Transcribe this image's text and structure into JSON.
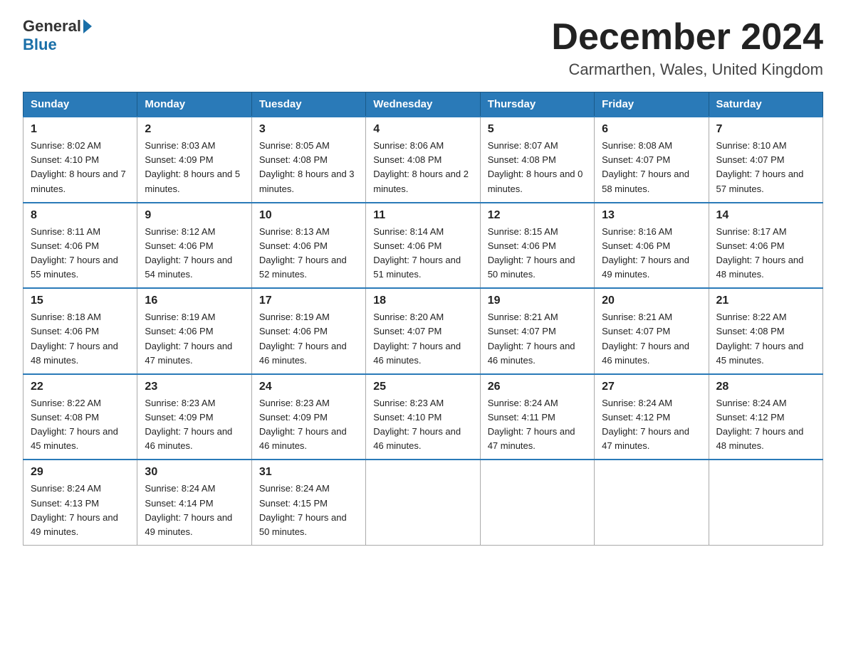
{
  "logo": {
    "general": "General",
    "blue": "Blue"
  },
  "title": "December 2024",
  "location": "Carmarthen, Wales, United Kingdom",
  "weekdays": [
    "Sunday",
    "Monday",
    "Tuesday",
    "Wednesday",
    "Thursday",
    "Friday",
    "Saturday"
  ],
  "weeks": [
    [
      {
        "day": "1",
        "sunrise": "8:02 AM",
        "sunset": "4:10 PM",
        "daylight": "8 hours and 7 minutes."
      },
      {
        "day": "2",
        "sunrise": "8:03 AM",
        "sunset": "4:09 PM",
        "daylight": "8 hours and 5 minutes."
      },
      {
        "day": "3",
        "sunrise": "8:05 AM",
        "sunset": "4:08 PM",
        "daylight": "8 hours and 3 minutes."
      },
      {
        "day": "4",
        "sunrise": "8:06 AM",
        "sunset": "4:08 PM",
        "daylight": "8 hours and 2 minutes."
      },
      {
        "day": "5",
        "sunrise": "8:07 AM",
        "sunset": "4:08 PM",
        "daylight": "8 hours and 0 minutes."
      },
      {
        "day": "6",
        "sunrise": "8:08 AM",
        "sunset": "4:07 PM",
        "daylight": "7 hours and 58 minutes."
      },
      {
        "day": "7",
        "sunrise": "8:10 AM",
        "sunset": "4:07 PM",
        "daylight": "7 hours and 57 minutes."
      }
    ],
    [
      {
        "day": "8",
        "sunrise": "8:11 AM",
        "sunset": "4:06 PM",
        "daylight": "7 hours and 55 minutes."
      },
      {
        "day": "9",
        "sunrise": "8:12 AM",
        "sunset": "4:06 PM",
        "daylight": "7 hours and 54 minutes."
      },
      {
        "day": "10",
        "sunrise": "8:13 AM",
        "sunset": "4:06 PM",
        "daylight": "7 hours and 52 minutes."
      },
      {
        "day": "11",
        "sunrise": "8:14 AM",
        "sunset": "4:06 PM",
        "daylight": "7 hours and 51 minutes."
      },
      {
        "day": "12",
        "sunrise": "8:15 AM",
        "sunset": "4:06 PM",
        "daylight": "7 hours and 50 minutes."
      },
      {
        "day": "13",
        "sunrise": "8:16 AM",
        "sunset": "4:06 PM",
        "daylight": "7 hours and 49 minutes."
      },
      {
        "day": "14",
        "sunrise": "8:17 AM",
        "sunset": "4:06 PM",
        "daylight": "7 hours and 48 minutes."
      }
    ],
    [
      {
        "day": "15",
        "sunrise": "8:18 AM",
        "sunset": "4:06 PM",
        "daylight": "7 hours and 48 minutes."
      },
      {
        "day": "16",
        "sunrise": "8:19 AM",
        "sunset": "4:06 PM",
        "daylight": "7 hours and 47 minutes."
      },
      {
        "day": "17",
        "sunrise": "8:19 AM",
        "sunset": "4:06 PM",
        "daylight": "7 hours and 46 minutes."
      },
      {
        "day": "18",
        "sunrise": "8:20 AM",
        "sunset": "4:07 PM",
        "daylight": "7 hours and 46 minutes."
      },
      {
        "day": "19",
        "sunrise": "8:21 AM",
        "sunset": "4:07 PM",
        "daylight": "7 hours and 46 minutes."
      },
      {
        "day": "20",
        "sunrise": "8:21 AM",
        "sunset": "4:07 PM",
        "daylight": "7 hours and 46 minutes."
      },
      {
        "day": "21",
        "sunrise": "8:22 AM",
        "sunset": "4:08 PM",
        "daylight": "7 hours and 45 minutes."
      }
    ],
    [
      {
        "day": "22",
        "sunrise": "8:22 AM",
        "sunset": "4:08 PM",
        "daylight": "7 hours and 45 minutes."
      },
      {
        "day": "23",
        "sunrise": "8:23 AM",
        "sunset": "4:09 PM",
        "daylight": "7 hours and 46 minutes."
      },
      {
        "day": "24",
        "sunrise": "8:23 AM",
        "sunset": "4:09 PM",
        "daylight": "7 hours and 46 minutes."
      },
      {
        "day": "25",
        "sunrise": "8:23 AM",
        "sunset": "4:10 PM",
        "daylight": "7 hours and 46 minutes."
      },
      {
        "day": "26",
        "sunrise": "8:24 AM",
        "sunset": "4:11 PM",
        "daylight": "7 hours and 47 minutes."
      },
      {
        "day": "27",
        "sunrise": "8:24 AM",
        "sunset": "4:12 PM",
        "daylight": "7 hours and 47 minutes."
      },
      {
        "day": "28",
        "sunrise": "8:24 AM",
        "sunset": "4:12 PM",
        "daylight": "7 hours and 48 minutes."
      }
    ],
    [
      {
        "day": "29",
        "sunrise": "8:24 AM",
        "sunset": "4:13 PM",
        "daylight": "7 hours and 49 minutes."
      },
      {
        "day": "30",
        "sunrise": "8:24 AM",
        "sunset": "4:14 PM",
        "daylight": "7 hours and 49 minutes."
      },
      {
        "day": "31",
        "sunrise": "8:24 AM",
        "sunset": "4:15 PM",
        "daylight": "7 hours and 50 minutes."
      },
      null,
      null,
      null,
      null
    ]
  ],
  "labels": {
    "sunrise_prefix": "Sunrise: ",
    "sunset_prefix": "Sunset: ",
    "daylight_prefix": "Daylight: "
  }
}
